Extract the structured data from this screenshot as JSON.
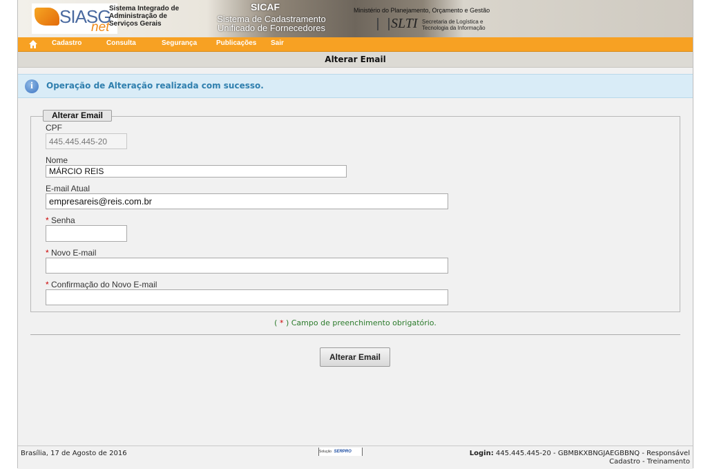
{
  "banner": {
    "logo_main": "SIASG",
    "logo_sub": "net",
    "siasg_name": [
      "Sistema Integrado de",
      "Administração de",
      "Serviços Gerais"
    ],
    "sicaf_title": "SICAF",
    "sicaf_subtitle": [
      "Sistema de Cadastramento",
      "Unificado de Fornecedores"
    ],
    "ministry": "Ministério do Planejamento, Orçamento e Gestão",
    "slti_logo": "SLTI",
    "slti_name": [
      "Secretaria de Logística e",
      "Tecnologia da Informação"
    ]
  },
  "menu": {
    "home_icon": "home-icon",
    "items": [
      "Cadastro",
      "Consulta",
      "Segurança",
      "Publicações",
      "Sair"
    ]
  },
  "page_title": "Alterar Email",
  "info": {
    "icon": "info-icon",
    "message": "Operação de Alteração realizada com sucesso."
  },
  "form": {
    "legend": "Alterar Email",
    "required_mark": "*",
    "cpf": {
      "label": "CPF",
      "value": "445.445.445-20"
    },
    "nome": {
      "label": "Nome",
      "value": "MÁRCIO REIS"
    },
    "email_atual": {
      "label": "E-mail Atual",
      "value": "empresareis@reis.com.br"
    },
    "senha": {
      "label": "Senha",
      "value": ""
    },
    "novo_email": {
      "label": "Novo E-mail",
      "value": ""
    },
    "confirmacao": {
      "label": "Confirmação do Novo E-mail",
      "value": ""
    },
    "required_note_open": "(",
    "required_note_star": "*",
    "required_note_rest": ") Campo de preenchimento obrigatório.",
    "submit_label": "Alterar Email"
  },
  "footer": {
    "date": "Brasília, 17 de Agosto de 2016",
    "serpro_prefix": "Solução",
    "serpro_brand": "SERPRO",
    "login_label": "Login:",
    "login_value": "445.445.445-20 - GBMBKXBNGJAEGBBNQ - Responsável",
    "login_line2": "Cadastro - Treinamento"
  },
  "colors": {
    "menu_bar": "#f7a123",
    "info_background": "#d9ecf7",
    "info_text": "#2f7fae",
    "required_note": "#2a7a2a"
  }
}
